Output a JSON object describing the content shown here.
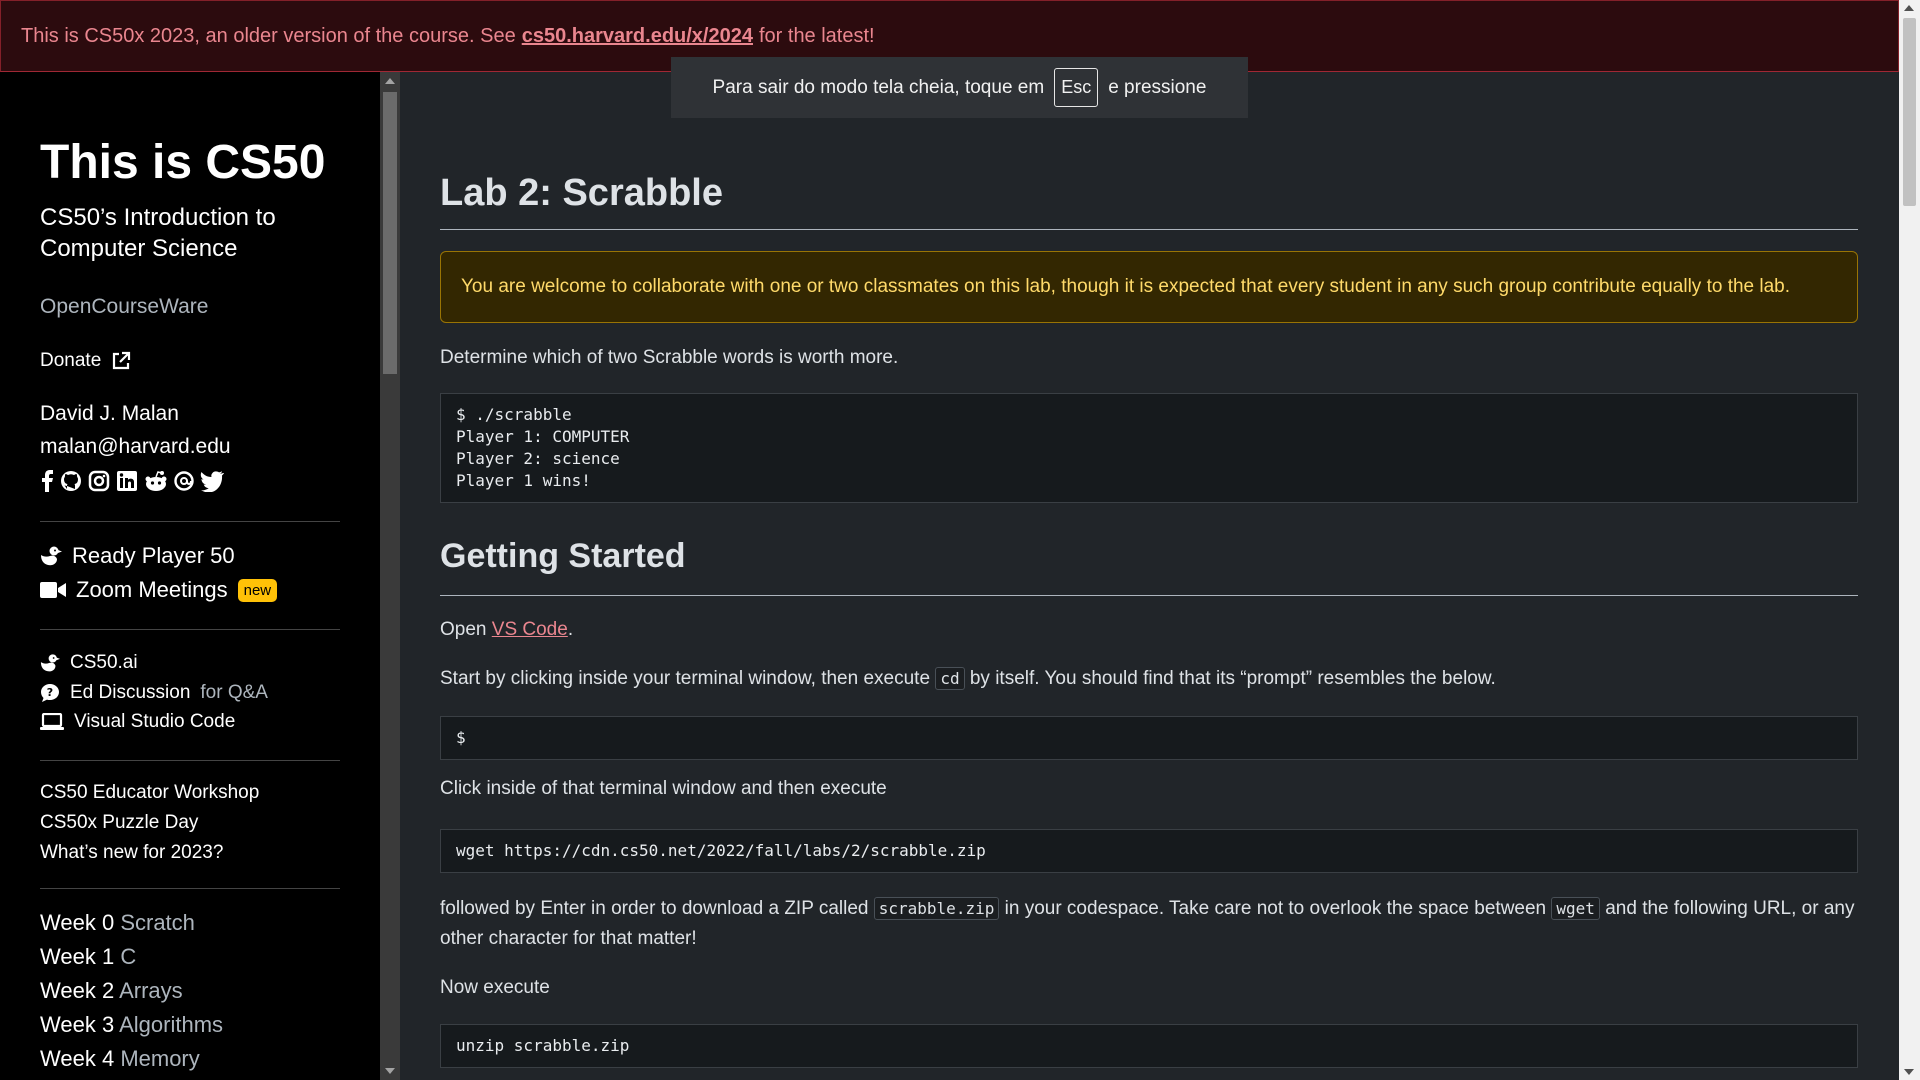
{
  "banner": {
    "text_before": "This is CS50x 2023, an older version of the course. See",
    "link": "cs50.harvard.edu/x/2024",
    "text_after": "for the latest!"
  },
  "toast": {
    "before": "Para sair do modo tela cheia, toque em",
    "key": "Esc",
    "after": "e pressione"
  },
  "sidebar": {
    "title": "This is CS50",
    "subtitle": "CS50’s Introduction to Computer Science",
    "ocw": "OpenCourseWare",
    "donate": "Donate",
    "author": "David J. Malan",
    "email": "malan@harvard.edu",
    "social_icons": [
      "facebook-icon",
      "github-icon",
      "instagram-icon",
      "linkedin-icon",
      "reddit-icon",
      "threads-icon",
      "twitter-icon"
    ],
    "featured": [
      {
        "label": "Ready Player 50",
        "icon": "duck-icon"
      },
      {
        "label": "Zoom Meetings",
        "icon": "video-camera-icon",
        "badge": "new"
      }
    ],
    "tools": [
      {
        "label": "CS50.ai",
        "icon": "duck-icon",
        "suffix": ""
      },
      {
        "label": "Ed Discussion",
        "icon": "chat-icon",
        "suffix": "for Q&A"
      },
      {
        "label": "Visual Studio Code",
        "icon": "laptop-icon",
        "suffix": ""
      }
    ],
    "links": [
      "CS50 Educator Workshop",
      "CS50x Puzzle Day",
      "What’s new for 2023?"
    ],
    "weeks": [
      {
        "num": "Week 0",
        "topic": "Scratch"
      },
      {
        "num": "Week 1",
        "topic": "C"
      },
      {
        "num": "Week 2",
        "topic": "Arrays"
      },
      {
        "num": "Week 3",
        "topic": "Algorithms"
      },
      {
        "num": "Week 4",
        "topic": "Memory"
      }
    ]
  },
  "main": {
    "heading": "Lab 2: Scrabble",
    "alert": "You are welcome to collaborate with one or two classmates on this lab, though it is expected that every student in any such group contribute equally to the lab.",
    "intro": "Determine which of two Scrabble words is worth more.",
    "demo_code": "$ ./scrabble\nPlayer 1: COMPUTER\nPlayer 2: science\nPlayer 1 wins!",
    "heading2": "Getting Started",
    "open_text": "Open",
    "open_link": "VS Code",
    "start_before": "Start by clicking inside your terminal window, then execute",
    "start_code": "cd",
    "start_after": "by itself. You should find that its “prompt” resembles the below.",
    "prompt_code": "$",
    "click_text": "Click inside of that terminal window and then execute",
    "wget_code": "wget https://cdn.cs50.net/2022/fall/labs/2/scrabble.zip",
    "follow_1": "followed by Enter in order to download a ZIP called",
    "follow_code1": "scrabble.zip",
    "follow_2": "in your codespace. Take care not to overlook the space between",
    "follow_code2": "wget",
    "follow_3": "and the following URL, or any other character for that matter!",
    "now_text": "Now execute",
    "unzip_code": "unzip scrabble.zip"
  },
  "colors": {
    "banner_bg": "#2c0b0e",
    "banner_text": "#ea868f",
    "alert_bg": "#332701",
    "alert_text": "#ffda6a",
    "badge": "#ffc107"
  }
}
